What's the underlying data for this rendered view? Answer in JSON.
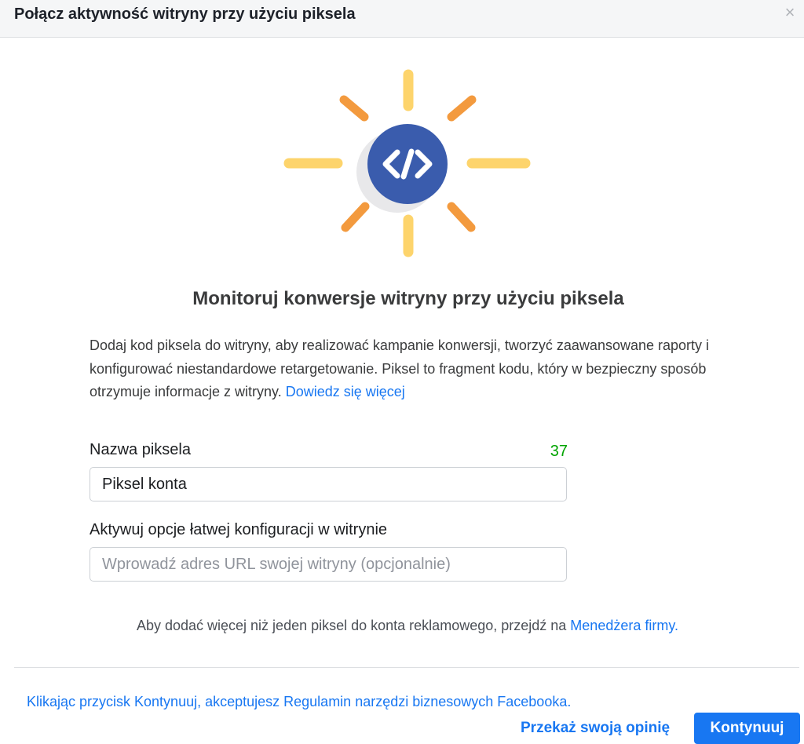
{
  "header": {
    "title": "Połącz aktywność witryny przy użyciu piksela",
    "close_glyph": "×"
  },
  "illustration": {
    "icon": "code-icon",
    "circle_color": "#3a5cad",
    "shadow_color": "#e8e8ea",
    "ray_yellow": "#fdd46c",
    "ray_orange": "#f39a3e"
  },
  "main": {
    "heading": "Monitoruj konwersje witryny przy użyciu piksela",
    "description": "Dodaj kod piksela do witryny, aby realizować kampanie konwersji, tworzyć zaawansowane raporty i konfigurować niestandardowe retargetowanie. Piksel to fragment kodu, który w bezpieczny sposób otrzymuje informacje z witryny.",
    "learn_more": "Dowiedz się więcej"
  },
  "form": {
    "pixel_name_label": "Nazwa piksela",
    "pixel_name_counter": "37",
    "pixel_name_value": "Piksel konta",
    "url_label": "Aktywuj opcje łatwej konfiguracji w witrynie",
    "url_placeholder": "Wprowadź adres URL swojej witryny (opcjonalnie)"
  },
  "note": {
    "text": "Aby dodać więcej niż jeden piksel do konta reklamowego, przejdź na",
    "link": "Menedżera firmy."
  },
  "footer": {
    "terms": "Klikając przycisk Kontynuuj, akceptujesz Regulamin narzędzi biznesowych Facebooka.",
    "feedback": "Przekaż swoją opinię",
    "continue": "Kontynuuj"
  },
  "colors": {
    "accent": "#1877f2",
    "counter": "#00a400"
  }
}
